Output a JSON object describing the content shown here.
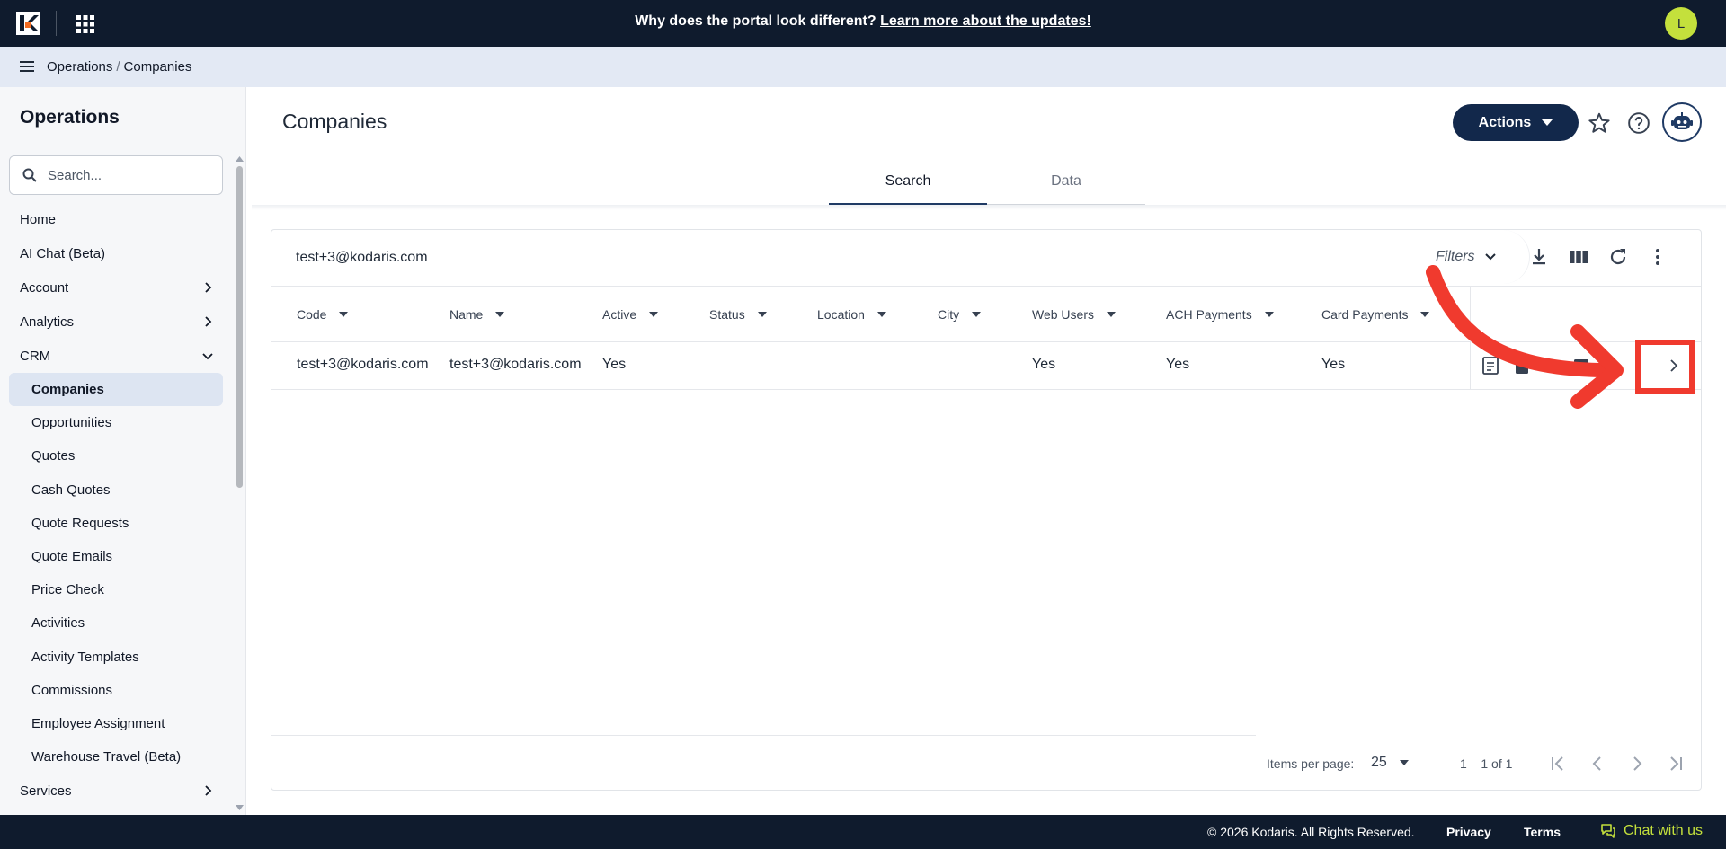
{
  "topbar": {
    "banner_text": "Why does the portal look different?",
    "banner_link": "Learn more about the updates!",
    "avatar_initial": "L",
    "accent_color": "#c4e03c"
  },
  "breadcrumb": {
    "parent": "Operations",
    "current": "Companies"
  },
  "sidebar": {
    "title": "Operations",
    "search_placeholder": "Search...",
    "items": [
      {
        "label": "Home",
        "icon": ""
      },
      {
        "label": "AI Chat (Beta)",
        "icon": ""
      },
      {
        "label": "Account",
        "icon": "chevron-right-icon"
      },
      {
        "label": "Analytics",
        "icon": "chevron-right-icon"
      },
      {
        "label": "CRM",
        "icon": "chevron-down-icon"
      },
      {
        "label": "Companies",
        "active": true
      },
      {
        "label": "Opportunities"
      },
      {
        "label": "Quotes"
      },
      {
        "label": "Cash Quotes"
      },
      {
        "label": "Quote Requests"
      },
      {
        "label": "Quote Emails"
      },
      {
        "label": "Price Check"
      },
      {
        "label": "Activities"
      },
      {
        "label": "Activity Templates"
      },
      {
        "label": "Commissions"
      },
      {
        "label": "Employee Assignment"
      },
      {
        "label": "Warehouse Travel (Beta)"
      },
      {
        "label": "Services",
        "icon": "chevron-right-icon"
      }
    ]
  },
  "main": {
    "title": "Companies",
    "actions_label": "Actions",
    "tabs": [
      {
        "label": "Search",
        "active": true
      },
      {
        "label": "Data",
        "active": false
      }
    ]
  },
  "grid": {
    "search_value": "test+3@kodaris.com",
    "filters_label": "Filters",
    "columns": [
      "Code",
      "Name",
      "Active",
      "Status",
      "Location",
      "City",
      "Web Users",
      "ACH Payments",
      "Card Payments"
    ],
    "rows": [
      [
        "test+3@kodaris.com",
        "test+3@kodaris.com",
        "Yes",
        "",
        "",
        "",
        "Yes",
        "Yes",
        "Yes"
      ]
    ],
    "items_per_page_label": "Items per page:",
    "items_per_page": "25",
    "range": "1 – 1 of 1"
  },
  "footer": {
    "copyright": "© 2026 Kodaris. All Rights Reserved.",
    "privacy": "Privacy",
    "terms": "Terms",
    "chat": "Chat with us"
  },
  "annotation_color": "#f03a2e"
}
